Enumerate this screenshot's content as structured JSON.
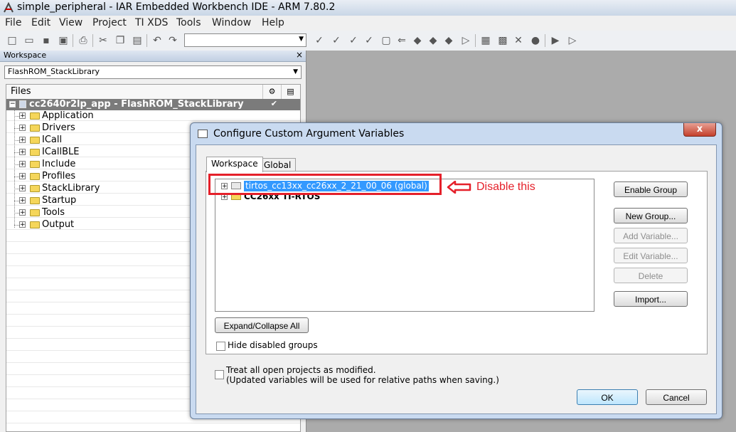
{
  "window": {
    "title": "simple_peripheral - IAR Embedded Workbench IDE - ARM 7.80.2"
  },
  "menu": [
    "File",
    "Edit",
    "View",
    "Project",
    "TI XDS",
    "Tools",
    "Window",
    "Help"
  ],
  "toolbar": {
    "combo_value": ""
  },
  "workspace": {
    "header": "Workspace",
    "close_label": "×",
    "configuration": "FlashROM_StackLibrary",
    "files_header": "Files",
    "project": "cc2640r2lp_app - FlashROM_StackLibrary",
    "project_check": "✔",
    "folders": [
      "Application",
      "Drivers",
      "ICall",
      "ICallBLE",
      "Include",
      "Profiles",
      "StackLibrary",
      "Startup",
      "Tools",
      "Output"
    ]
  },
  "dialog": {
    "title": "Configure Custom Argument Variables",
    "close_label": "x",
    "tabs": [
      "Workspace",
      "Global"
    ],
    "groups": [
      {
        "label": "tirtos_cc13xx_cc26xx_2_21_00_06 (global)"
      },
      {
        "label": "CC26xx TI-RTOS"
      }
    ],
    "buttons": {
      "enable_group": "Enable Group",
      "new_group": "New Group...",
      "add_variable": "Add Variable...",
      "edit_variable": "Edit Variable...",
      "delete": "Delete",
      "import": "Import...",
      "expand_collapse": "Expand/Collapse All",
      "ok": "OK",
      "cancel": "Cancel"
    },
    "hide_disabled_label": "Hide disabled groups",
    "treat_modified_line1": "Treat all open projects as modified.",
    "treat_modified_line2": "(Updated variables will be used for relative paths when saving.)"
  },
  "annotation": {
    "text": "Disable this",
    "color": "#e5202a"
  }
}
